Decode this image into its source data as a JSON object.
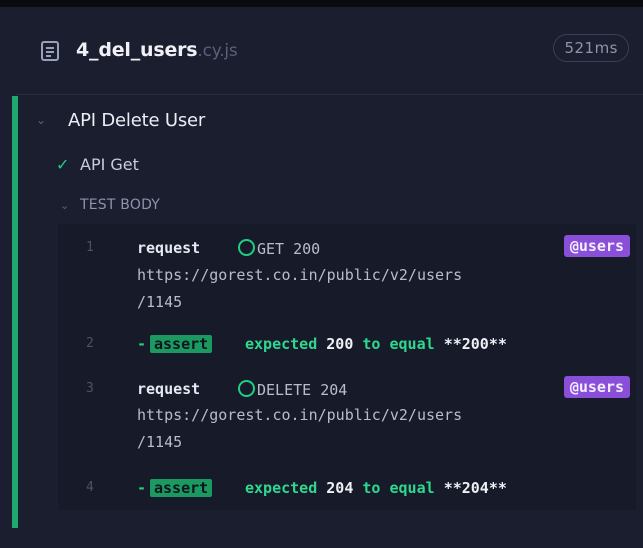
{
  "spec": {
    "name": "4_del_users",
    "extension": ".cy.js",
    "duration": "521ms"
  },
  "suite": {
    "title": "API Delete User",
    "test": {
      "title": "API Get",
      "body_label": "TEST BODY",
      "commands": [
        {
          "number": "1",
          "name": "request",
          "method": "GET 200",
          "url_line1": "https://gorest.co.in/public/v2/users",
          "url_line2": "/1145",
          "alias": "@users"
        },
        {
          "number": "2",
          "prefix": "-",
          "badge": "assert",
          "msg_1": "expected ",
          "value_1": "200",
          "msg_2": " to equal ",
          "value_2": "**200**"
        },
        {
          "number": "3",
          "name": "request",
          "method": "DELETE 204",
          "url_line1": "https://gorest.co.in/public/v2/users",
          "url_line2": "/1145",
          "alias": "@users"
        },
        {
          "number": "4",
          "prefix": "-",
          "badge": "assert",
          "msg_1": "expected ",
          "value_1": "204",
          "msg_2": " to equal ",
          "value_2": "**204**"
        }
      ]
    }
  },
  "colors": {
    "passed": "#1fa971",
    "alias": "#8a4fd8",
    "assert": "#1a9a60"
  }
}
